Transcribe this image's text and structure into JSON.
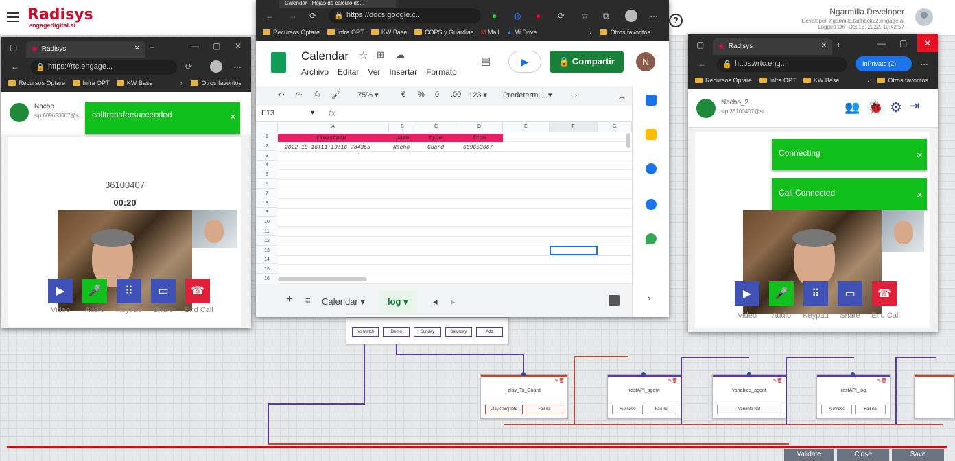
{
  "app": {
    "logo": "Radisys",
    "logo_sub": "engagedigital.ai",
    "user": "Ngarmilla Developer",
    "user_line1": "Developer, ngarmilla.tadhack22.engage.ai",
    "user_line2": "Logged On -Oct 16, 2022, 10:42:57",
    "help": "?"
  },
  "flow": {
    "menu_buttons": [
      "No Match",
      "Demo",
      "Sunday",
      "Saturday",
      "Add"
    ],
    "nodes": [
      {
        "title": "play_To_Guard",
        "buttons": [
          "Play Complete",
          "Failure"
        ],
        "color": "#b34a3a"
      },
      {
        "title": "restAPI_agent",
        "buttons": [
          "Success",
          "Failure"
        ],
        "color": "#5a3a9a"
      },
      {
        "title": "variables_agent",
        "buttons": [
          "Variable Set"
        ],
        "color": "#5a3a9a"
      },
      {
        "title": "restAPI_log",
        "buttons": [
          "Success",
          "Failure"
        ],
        "color": "#5a3a9a"
      }
    ],
    "footer_buttons": [
      "Validate",
      "Close",
      "Save"
    ]
  },
  "left_window": {
    "tab_title": "Radisys",
    "url": "https://rtc.engage...",
    "bookmarks": [
      "Recursos Optare",
      "Infra OPT",
      "KW Base"
    ],
    "bookmarks_more": "Otros favoritos",
    "caller_name": "Nacho",
    "caller_sip": "sip:609653667@s...",
    "toast": "calltransfersucceeded",
    "number": "36100407",
    "timer": "00:20",
    "controls": [
      "Video",
      "Audio",
      "Keypad",
      "Share",
      "End Call"
    ]
  },
  "sheets_window": {
    "tab_title": "Calendar - Hojas de cálculo de...",
    "url": "https://docs.google.c...",
    "bookmarks": [
      "Recursos Optare",
      "Infra OPT",
      "KW Base",
      "COPS y Guardias",
      "Mail",
      "Mi Drive"
    ],
    "bookmarks_more": "Otros favoritos",
    "doc_title": "Calendar",
    "menus": [
      "Archivo",
      "Editar",
      "Ver",
      "Insertar",
      "Formato"
    ],
    "share": "Compartir",
    "avatar_letter": "N",
    "zoom": "75%",
    "currency": "€",
    "percent": "%",
    "dec1": ".0",
    "dec2": ".00",
    "numfmt": "123",
    "font": "Predetermi...",
    "cell_ref": "F13",
    "fx": "fx",
    "columns": [
      "A",
      "B",
      "C",
      "D",
      "E",
      "F",
      "G"
    ],
    "headers": [
      "timestamp",
      "name",
      "type",
      "from"
    ],
    "row": [
      "2022-10-16T11:19:16.784355",
      "Nacho",
      "Guard",
      "609653667"
    ],
    "row_numbers": [
      "1",
      "2",
      "3",
      "4",
      "5",
      "6",
      "7",
      "8",
      "9",
      "10",
      "11",
      "12",
      "13",
      "14",
      "15",
      "16"
    ],
    "sheet_tabs": [
      "Calendar",
      "log"
    ],
    "active_sheet": "log"
  },
  "right_window": {
    "tab_title": "Radisys",
    "url": "https://rtc.eng...",
    "inprivate": "InPrivate (2)",
    "bookmarks": [
      "Recursos Optare",
      "Infra OPT",
      "KW Base"
    ],
    "bookmarks_more": "Otros favoritos",
    "caller_name": "Nacho_2",
    "caller_sip": "sip:36100407@si...",
    "toast1": "Connecting",
    "toast2": "Call Connected",
    "controls": [
      "Video",
      "Audio",
      "Keypad",
      "Share",
      "End Call"
    ]
  },
  "colors": {
    "brand": "#c8102e",
    "toast": "#11c01d",
    "sheet_header": "#e91e63",
    "share": "#188038"
  }
}
